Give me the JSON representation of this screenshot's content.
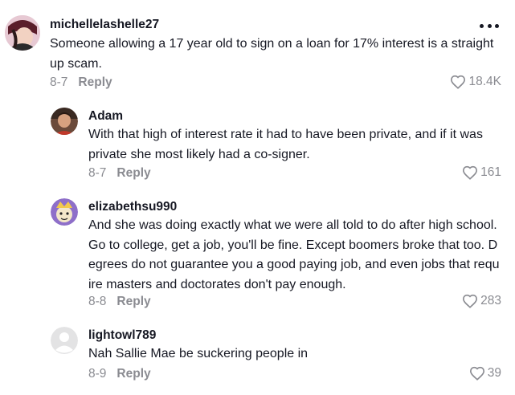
{
  "comments": [
    {
      "username": "michellelashelle27",
      "text": "Someone allowing a 17 year old to sign on a loan for 17% interest is a straight up scam.",
      "date": "8-7",
      "reply_label": "Reply",
      "likes": "18.4K"
    },
    {
      "username": "Adam",
      "text": "With that high of interest rate it had to have been private, and if it was private she most likely had a co-signer.",
      "date": "8-7",
      "reply_label": "Reply",
      "likes": "161"
    },
    {
      "username": "elizabethsu990",
      "text": "And she was doing exactly what we were all told to do after high school. Go to college, get a job, you'll be fine. Except boomers broke that too. Degrees do not guarantee you a good paying job, and even jobs that require masters and doctorates don't pay enough.",
      "date": "8-8",
      "reply_label": "Reply",
      "likes": "283"
    },
    {
      "username": "lightowl789",
      "text": "Nah Sallie Mae be suckering people in",
      "date": "8-9",
      "reply_label": "Reply",
      "likes": "39"
    }
  ],
  "icons": {
    "more": "more-options-icon",
    "like": "heart-outline-icon"
  },
  "colors": {
    "text": "#161823",
    "secondary": "#8a8b91"
  }
}
